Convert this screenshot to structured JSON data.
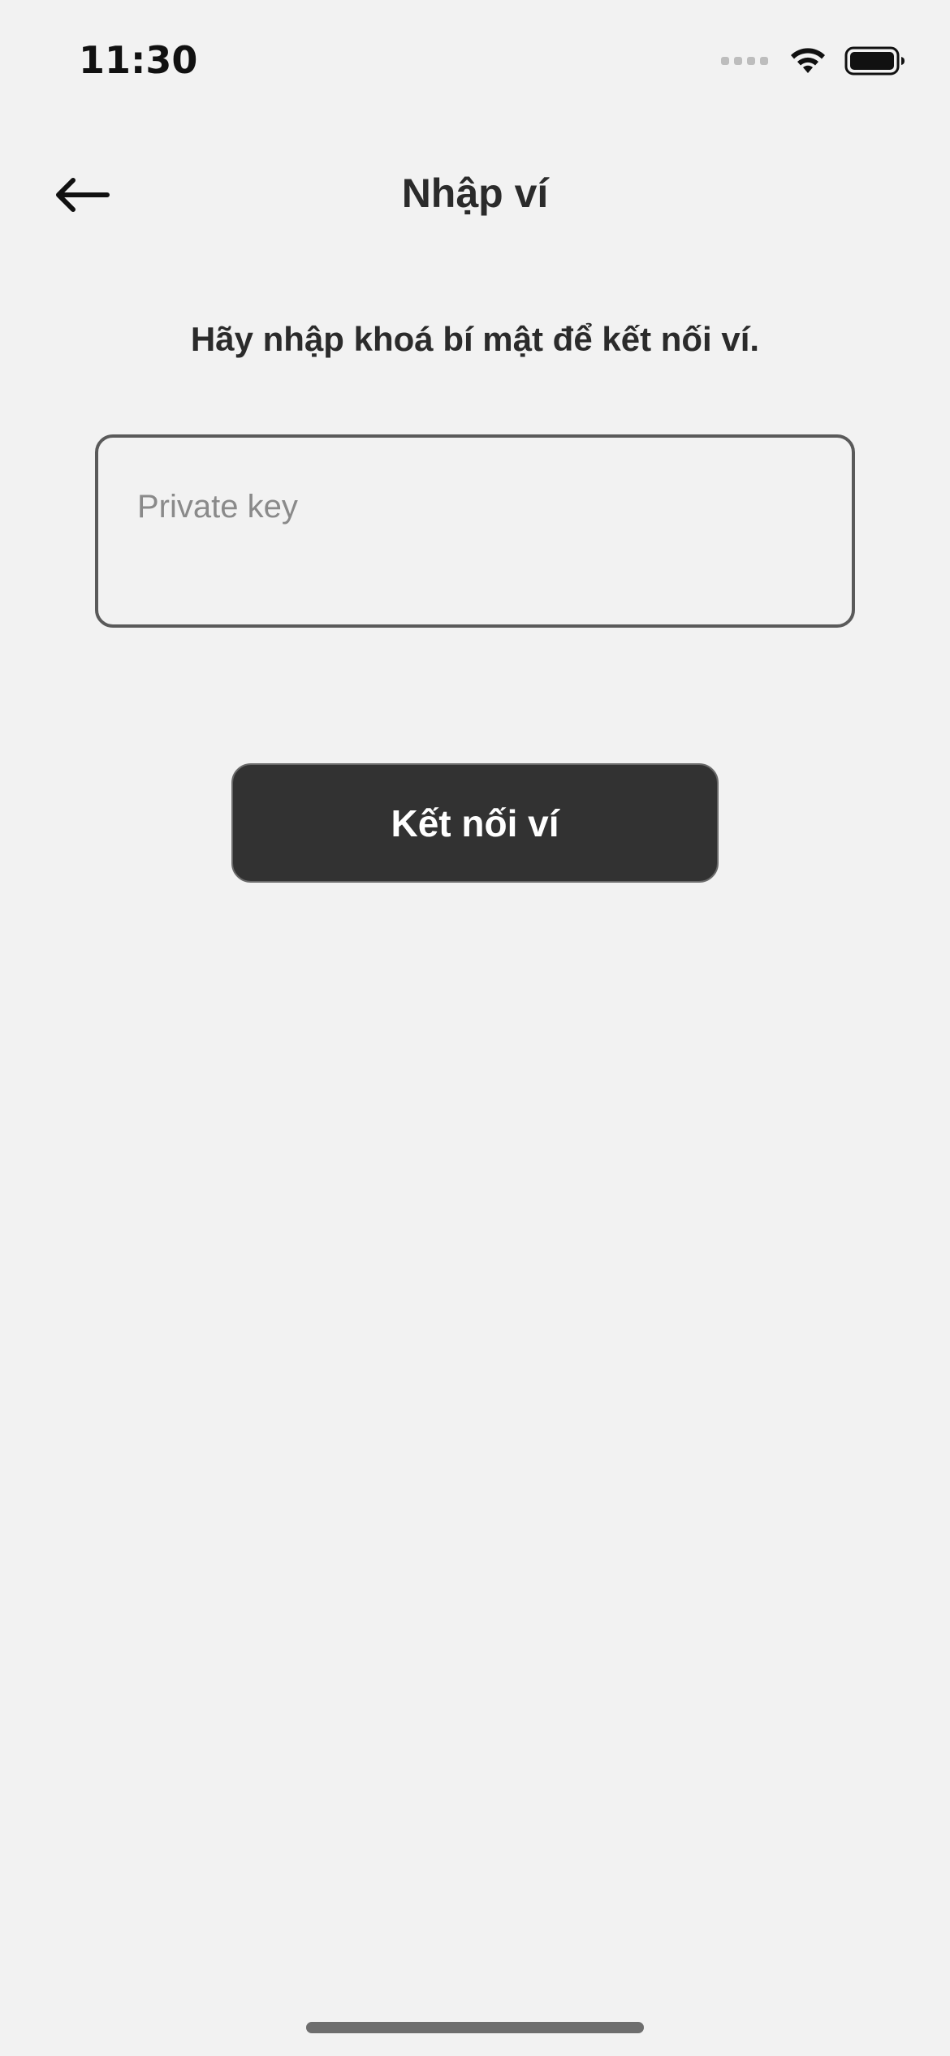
{
  "status_bar": {
    "time": "11:30",
    "signal_icon": "cellular-signal-icon",
    "wifi_icon": "wifi-icon",
    "battery_icon": "battery-icon"
  },
  "header": {
    "back_icon": "arrow-left-icon",
    "title": "Nhập ví"
  },
  "main": {
    "instruction": "Hãy nhập khoá bí mật để kết nối ví.",
    "private_key_input": {
      "value": "",
      "placeholder": "Private key"
    },
    "connect_button_label": "Kết nối ví"
  },
  "colors": {
    "background": "#f2f2f2",
    "button_background": "#323232",
    "button_text": "#ffffff",
    "input_border": "#5a5a5a",
    "text": "#2b2b2b"
  }
}
